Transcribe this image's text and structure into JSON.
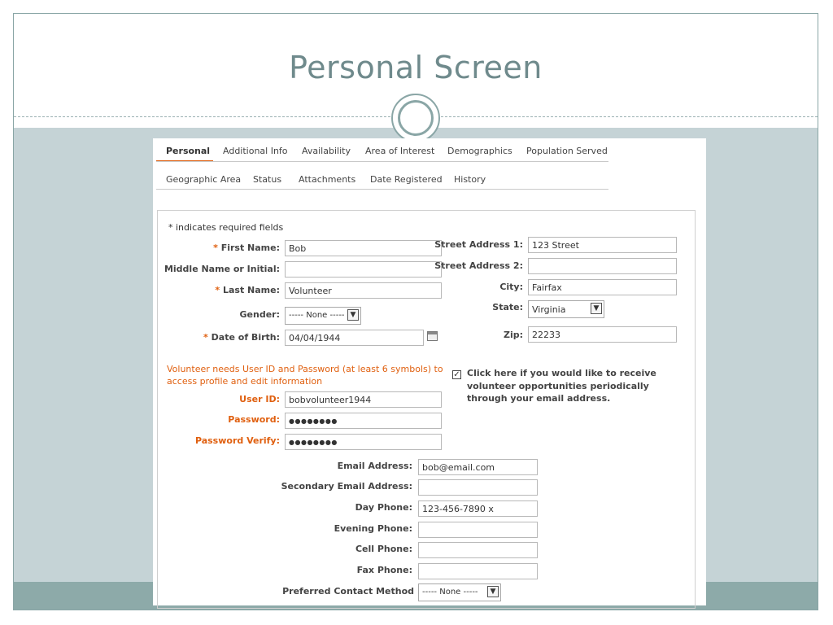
{
  "slide": {
    "title": "Personal Screen"
  },
  "tabs": {
    "row1": [
      "Personal",
      "Additional Info",
      "Availability",
      "Area of Interest",
      "Demographics",
      "Population Served"
    ],
    "row2": [
      "Geographic Area",
      "Status",
      "Attachments",
      "Date Registered",
      "History"
    ],
    "active": "Personal"
  },
  "form": {
    "required_note": "* indicates required fields",
    "required_mark": "*",
    "first_name": {
      "label": "First Name:",
      "value": "Bob"
    },
    "middle_name": {
      "label": "Middle Name or Initial:",
      "value": ""
    },
    "last_name": {
      "label": "Last Name:",
      "value": "Volunteer"
    },
    "gender": {
      "label": "Gender:",
      "value": "----- None -----"
    },
    "dob": {
      "label": "Date of Birth:",
      "value": "04/04/1944"
    },
    "street1": {
      "label": "Street Address 1:",
      "value": "123 Street"
    },
    "street2": {
      "label": "Street Address 2:",
      "value": ""
    },
    "city": {
      "label": "City:",
      "value": "Fairfax"
    },
    "state": {
      "label": "State:",
      "value": "Virginia"
    },
    "zip": {
      "label": "Zip:",
      "value": "22233"
    },
    "login_note": "Volunteer needs User ID and Password (at least 6 symbols) to access profile and edit information",
    "user_id": {
      "label": "User ID:",
      "value": "bobvolunteer1944"
    },
    "password": {
      "label": "Password:",
      "value": "●●●●●●●●"
    },
    "password_verify": {
      "label": "Password Verify:",
      "value": "●●●●●●●●"
    },
    "opt_in": {
      "checked": true,
      "checkmark": "✓",
      "text": "Click here if you would like to receive volunteer opportunities periodically through your email address."
    },
    "email": {
      "label": "Email Address:",
      "value": "bob@email.com"
    },
    "secondary_email": {
      "label": "Secondary Email Address:",
      "value": ""
    },
    "day_phone": {
      "label": "Day Phone:",
      "value": "123-456-7890 x"
    },
    "evening_phone": {
      "label": "Evening Phone:",
      "value": ""
    },
    "cell_phone": {
      "label": "Cell Phone:",
      "value": ""
    },
    "fax_phone": {
      "label": "Fax Phone:",
      "value": ""
    },
    "contact_method": {
      "label": "Preferred Contact Method",
      "value": "----- None -----"
    }
  },
  "icons": {
    "dropdown_arrow": "▼"
  }
}
